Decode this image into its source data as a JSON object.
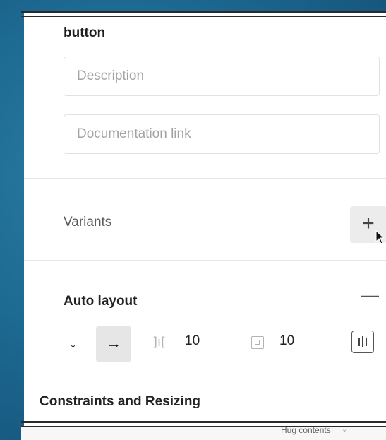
{
  "component": {
    "name": "button",
    "description_placeholder": "Description",
    "doclink_placeholder": "Documentation link"
  },
  "variants": {
    "title": "Variants",
    "add_icon": "plus-icon",
    "add_label": "+"
  },
  "auto_layout": {
    "title": "Auto layout",
    "remove_label": "—",
    "direction_vertical_label": "↓",
    "direction_horizontal_label": "→",
    "selected_direction": "horizontal",
    "spacing_icon": "spacing-between-icon",
    "spacing_glyph": "]ı[",
    "spacing_value": "10",
    "padding_icon": "padding-icon",
    "padding_value": "10",
    "alignment_icon": "alignment-icon"
  },
  "constraints": {
    "title": "Constraints and Resizing"
  },
  "underlay": {
    "hug_label": "Hug contents",
    "hug_chevron": "⌄"
  },
  "colors": {
    "background": "#1d6a93",
    "panel": "#ffffff",
    "selected_button": "#e6e6e6"
  }
}
